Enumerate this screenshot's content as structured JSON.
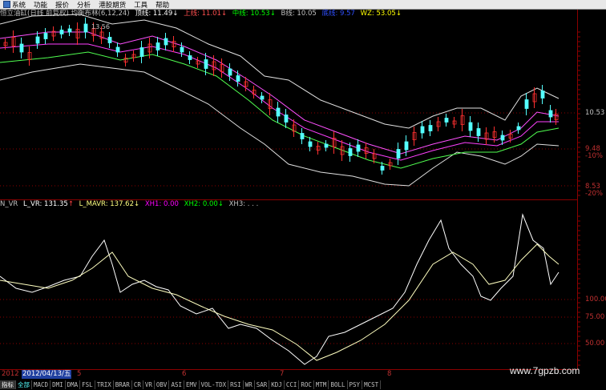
{
  "menu": {
    "items": [
      {
        "label": "系统"
      },
      {
        "label": "功能"
      },
      {
        "label": "报价"
      },
      {
        "label": "分析"
      },
      {
        "label": "港股期货"
      },
      {
        "label": "工具"
      },
      {
        "label": "帮助"
      }
    ]
  },
  "main_indicator": {
    "title": "恒立油缸(日线 前复权) 均衡布林(6,12,24)",
    "items": [
      {
        "label": "顶线: 11.49",
        "arrow": "↓",
        "color": "#ffffff"
      },
      {
        "label": "上线: 11.01",
        "arrow": "↓",
        "color": "#ff5050"
      },
      {
        "label": "中线: 10.53",
        "arrow": "↓",
        "color": "#00ff00"
      },
      {
        "label": "B线: 10.05",
        "arrow": "",
        "color": "#c0c0c0"
      },
      {
        "label": "底线: 9.57",
        "arrow": "",
        "color": "#3050ff"
      },
      {
        "label": "WZ: 53.05",
        "arrow": "↓",
        "color": "#ffff00"
      }
    ]
  },
  "price_axis": {
    "labels": [
      {
        "text": "10.53",
        "color": "#c0c0c0"
      },
      {
        "text": "9.48",
        "color": "#c03030"
      },
      {
        "text": "-10%",
        "color": "#c03030"
      },
      {
        "text": "8.53",
        "color": "#c03030"
      },
      {
        "text": "-20%",
        "color": "#c03030"
      }
    ],
    "high_marker": "13.56"
  },
  "sub_indicator": {
    "items": [
      {
        "label": "N_VR",
        "color": "#c0c0c0"
      },
      {
        "label": "L_VR: 131.35",
        "arrow": "↑",
        "color": "#ffffff"
      },
      {
        "label": "L_MAVR: 137.62",
        "arrow": "↓",
        "color": "#ffff80"
      },
      {
        "label": "XH1: 0.00",
        "color": "#ff00ff"
      },
      {
        "label": "XH2: 0.00",
        "arrow": "↓",
        "color": "#00ff00"
      },
      {
        "label": "XH3: . . .",
        "color": "#c0c0c0"
      }
    ]
  },
  "sub_axis": {
    "labels": [
      {
        "text": "100.00"
      },
      {
        "text": "75.00"
      },
      {
        "text": "50.00"
      }
    ]
  },
  "date_bar": {
    "year": "2012",
    "date": "2012/04/13/五",
    "months": [
      "5",
      "6",
      "7",
      "8"
    ]
  },
  "tabs": [
    {
      "label": "指标",
      "active": true
    },
    {
      "label": "全部",
      "active": false
    },
    {
      "label": "MACD"
    },
    {
      "label": "DMI"
    },
    {
      "label": "DMA"
    },
    {
      "label": "FSL"
    },
    {
      "label": "TRIX"
    },
    {
      "label": "BRAR"
    },
    {
      "label": "CR"
    },
    {
      "label": "VR"
    },
    {
      "label": "OBV"
    },
    {
      "label": "ASI"
    },
    {
      "label": "EMV"
    },
    {
      "label": "VOL-TDX"
    },
    {
      "label": "RSI"
    },
    {
      "label": "WR"
    },
    {
      "label": "SAR"
    },
    {
      "label": "KDJ"
    },
    {
      "label": "CCI"
    },
    {
      "label": "ROC"
    },
    {
      "label": "MTM"
    },
    {
      "label": "BOLL"
    },
    {
      "label": "PSY"
    },
    {
      "label": "MCST"
    }
  ],
  "watermark": "www.7gpzb.com",
  "colors": {
    "up": "#ff3030",
    "down": "#54ffff",
    "band_outer": "#e0e0e0",
    "band_upper": "#ff50ff",
    "band_mid": "#50ff50",
    "vr": "#ffffff",
    "mavr": "#ffffc0",
    "grid": "#8b0000"
  }
}
